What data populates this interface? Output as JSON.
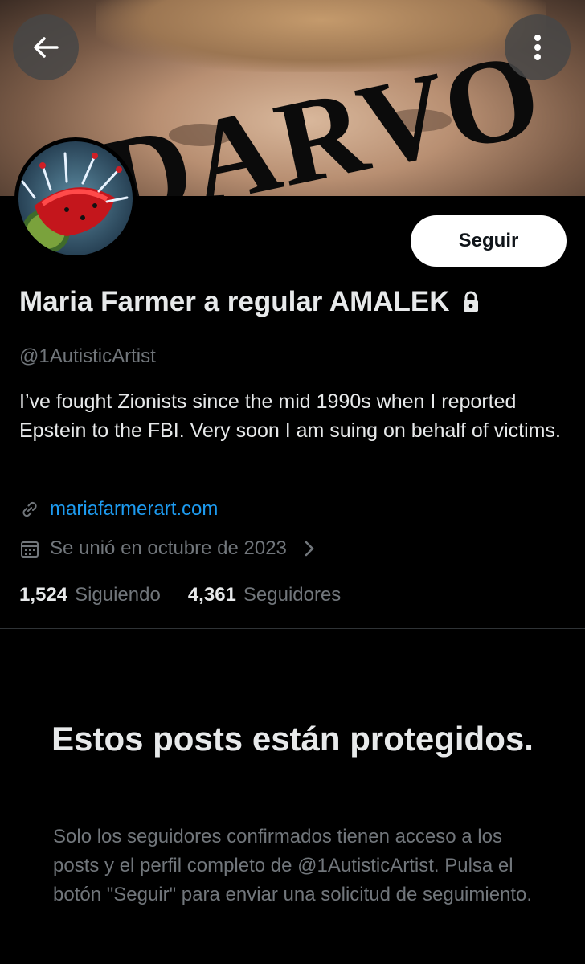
{
  "banner": {
    "overlay_text": "DARVO"
  },
  "profile": {
    "display_name": "Maria Farmer a regular AMALEK",
    "handle": "@1AutisticArtist",
    "bio": "I’ve fought Zionists since the mid 1990s when I reported Epstein to the FBI. Very soon I am suing on behalf of victims.",
    "website": "mariafarmerart.com",
    "joined": "Se unió en octubre de 2023",
    "protected": true
  },
  "actions": {
    "follow_label": "Seguir"
  },
  "stats": {
    "following_count": "1,524",
    "following_label": "Siguiendo",
    "followers_count": "4,361",
    "followers_label": "Seguidores"
  },
  "protected_notice": {
    "title": "Estos posts están protegidos.",
    "body": "Solo los seguidores confirmados tienen acceso a los posts y el perfil completo de @1AutisticArtist. Pulsa el botón \"Seguir\" para enviar una solicitud de seguimiento."
  },
  "icons": {
    "back": "arrow-left-icon",
    "more": "more-vertical-icon",
    "lock": "lock-icon",
    "link": "link-icon",
    "calendar": "calendar-icon",
    "chevron": "chevron-right-icon"
  },
  "colors": {
    "background": "#000000",
    "text_primary": "#e7e9ea",
    "text_secondary": "#71767b",
    "link": "#1d9bf0",
    "follow_button_bg": "#ffffff",
    "follow_button_text": "#0f1419",
    "divider": "#2f3336"
  }
}
